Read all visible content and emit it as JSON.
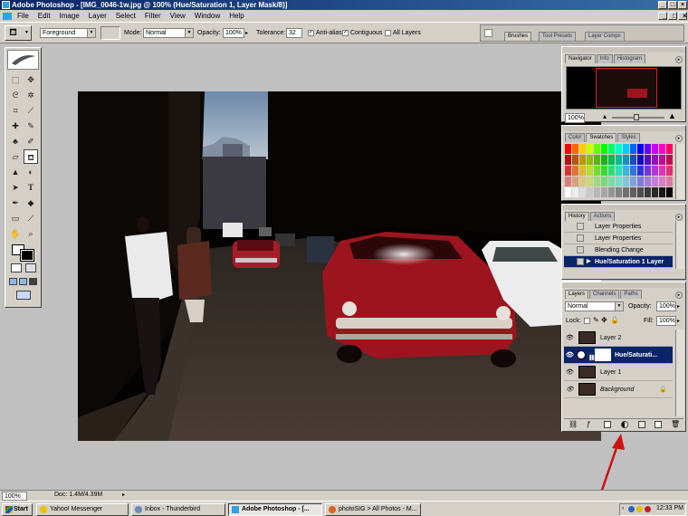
{
  "app": {
    "title": "Adobe Photoshop - [IMG_0046-1w.jpg @ 100% (Hue/Saturation 1, Layer Mask/8)]",
    "menu": [
      "File",
      "Edit",
      "Image",
      "Layer",
      "Select",
      "Filter",
      "View",
      "Window",
      "Help"
    ]
  },
  "options": {
    "fill_source": "Foreground",
    "mode_label": "Mode:",
    "mode_value": "Normal",
    "opacity_label": "Opacity:",
    "opacity_value": "100%",
    "tolerance_label": "Tolerance:",
    "tolerance_value": "32",
    "antialias_label": "Anti-alias",
    "contiguous_label": "Contiguous",
    "all_layers_label": "All Layers",
    "palette_well": [
      "Brushes",
      "Tool Presets",
      "Layer Comps"
    ]
  },
  "navigator": {
    "tabs": [
      "Navigator",
      "Info",
      "Histogram"
    ],
    "zoom": "100%"
  },
  "swatches": {
    "tabs": [
      "Color",
      "Swatches",
      "Styles"
    ]
  },
  "history": {
    "tabs": [
      "History",
      "Actions"
    ],
    "items": [
      "Layer Properties",
      "Layer Properties",
      "Blending Change",
      "Hue/Saturation 1 Layer"
    ]
  },
  "layers": {
    "tabs": [
      "Layers",
      "Channels",
      "Paths"
    ],
    "blend_mode": "Normal",
    "opacity_label": "Opacity:",
    "opacity_value": "100%",
    "lock_label": "Lock:",
    "fill_label": "Fill:",
    "fill_value": "100%",
    "items": [
      "Layer 2",
      "Hue/Saturati...",
      "Layer 1",
      "Background"
    ]
  },
  "status": {
    "zoom": "100%",
    "doc": "Doc: 1.4M/4.39M"
  },
  "taskbar": {
    "start": "Start",
    "items": [
      "Yahoo! Messenger",
      "Inbox - Thunderbird",
      "Adobe Photoshop - [...",
      "photoSIG > All Photos - M..."
    ],
    "clock": "12:33 PM"
  },
  "colors": {
    "title_gradient_start": "#0a246a",
    "title_gradient_end": "#3a6ea5",
    "chrome": "#d4d0c8",
    "workspace": "#c0c0c0",
    "selection": "#0a246a",
    "annotation_arrow": "#cc1111"
  }
}
